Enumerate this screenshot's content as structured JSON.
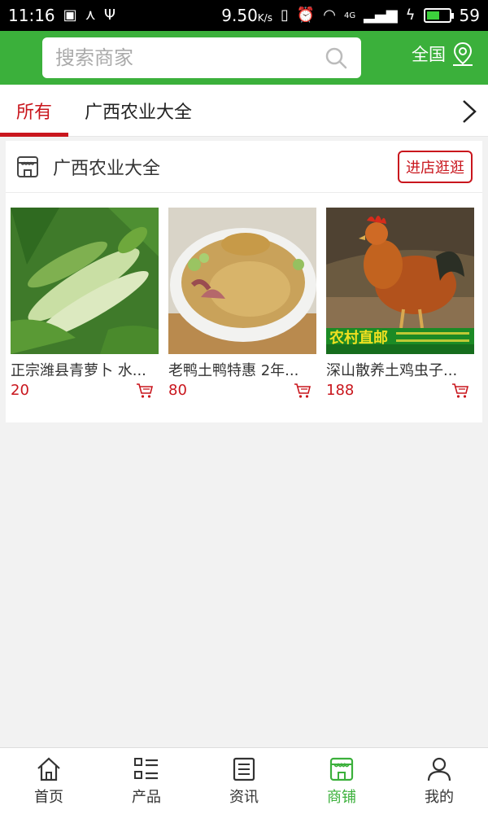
{
  "status_bar": {
    "time": "11:16",
    "speed": "9.50",
    "speed_unit": "K/s",
    "network": "4G",
    "battery": "59",
    "battery_level": 0.59
  },
  "header": {
    "search_placeholder": "搜索商家",
    "region": "全国"
  },
  "tabs": [
    {
      "label": "所有",
      "active": true
    },
    {
      "label": "广西农业大全",
      "active": false
    }
  ],
  "store": {
    "name": "广西农业大全",
    "enter_label": "进店逛逛",
    "products": [
      {
        "name": "正宗潍县青萝卜 水...",
        "price": "20"
      },
      {
        "name": "老鸭土鸭特惠 2年...",
        "price": "80"
      },
      {
        "name": "深山散养土鸡虫子...",
        "price": "188",
        "image_caption": "农村直邮"
      }
    ]
  },
  "bottom_nav": [
    {
      "label": "首页",
      "icon": "home-icon",
      "active": false
    },
    {
      "label": "产品",
      "icon": "list-icon",
      "active": false
    },
    {
      "label": "资讯",
      "icon": "news-icon",
      "active": false
    },
    {
      "label": "商铺",
      "icon": "store-icon",
      "active": true
    },
    {
      "label": "我的",
      "icon": "user-icon",
      "active": false
    }
  ],
  "colors": {
    "brand_green": "#3bb03b",
    "accent_red": "#c9161d"
  }
}
